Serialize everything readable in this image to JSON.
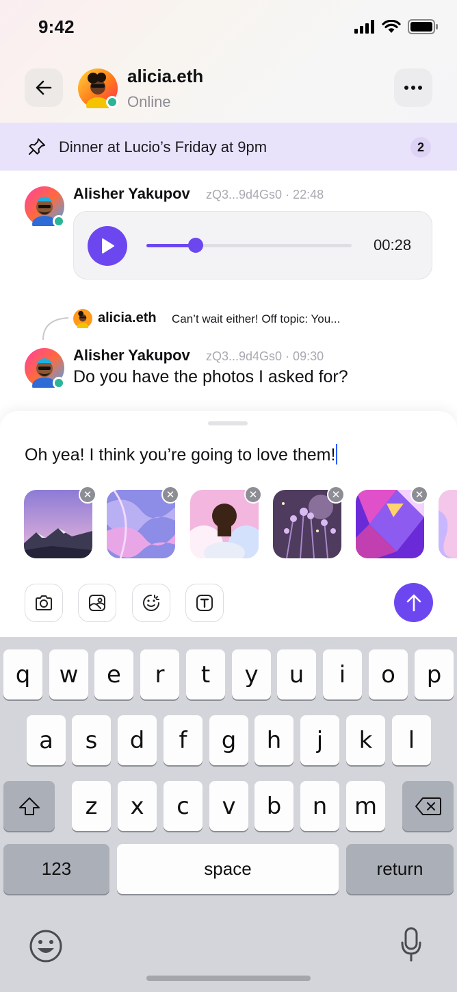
{
  "status_bar": {
    "time": "9:42"
  },
  "header": {
    "name": "alicia.eth",
    "status": "Online"
  },
  "pinned": {
    "text": "Dinner at Lucio’s Friday at 9pm",
    "count": "2"
  },
  "messages": [
    {
      "author": "Alisher Yakupov",
      "meta": "zQ3...9d4Gs0 · 22:48",
      "voice": {
        "duration": "00:28",
        "progress": 0.24
      }
    },
    {
      "reply": {
        "author": "alicia.eth",
        "text": "Can’t wait either! Off topic: You..."
      },
      "author": "Alisher Yakupov",
      "meta": "zQ3...9d4Gs0 · 09:30",
      "text": "Do you have the photos I asked for?"
    }
  ],
  "composer": {
    "draft": "Oh yea! I think you’re going to love them!",
    "attachments": [
      "mountain-photo",
      "marble-photo",
      "portrait-photo",
      "lavender-photo",
      "cube-photo",
      "swirl-photo"
    ],
    "tools": [
      "camera-icon",
      "image-icon",
      "sticker-icon",
      "text-format-icon"
    ],
    "accent": "#6c47f0"
  },
  "keyboard": {
    "row1": [
      "q",
      "w",
      "e",
      "r",
      "t",
      "y",
      "u",
      "i",
      "o",
      "p"
    ],
    "row2": [
      "a",
      "s",
      "d",
      "f",
      "g",
      "h",
      "j",
      "k",
      "l"
    ],
    "row3": [
      "z",
      "x",
      "c",
      "v",
      "b",
      "n",
      "m"
    ],
    "numbers": "123",
    "space": "space",
    "return": "return"
  }
}
